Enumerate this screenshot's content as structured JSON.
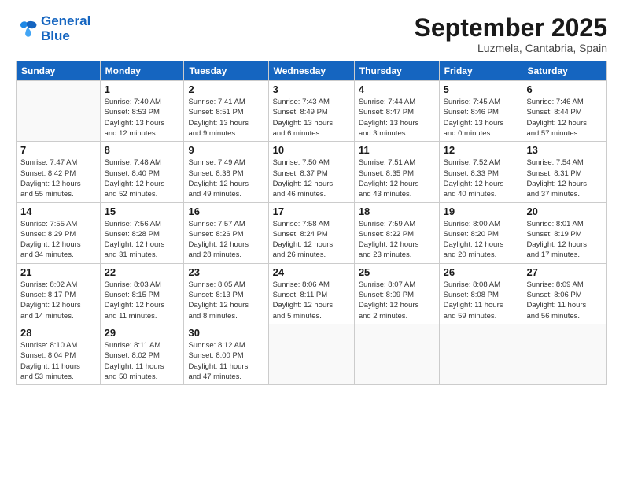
{
  "logo": {
    "line1": "General",
    "line2": "Blue"
  },
  "title": "September 2025",
  "location": "Luzmela, Cantabria, Spain",
  "weekdays": [
    "Sunday",
    "Monday",
    "Tuesday",
    "Wednesday",
    "Thursday",
    "Friday",
    "Saturday"
  ],
  "weeks": [
    [
      {
        "day": "",
        "info": ""
      },
      {
        "day": "1",
        "info": "Sunrise: 7:40 AM\nSunset: 8:53 PM\nDaylight: 13 hours\nand 12 minutes."
      },
      {
        "day": "2",
        "info": "Sunrise: 7:41 AM\nSunset: 8:51 PM\nDaylight: 13 hours\nand 9 minutes."
      },
      {
        "day": "3",
        "info": "Sunrise: 7:43 AM\nSunset: 8:49 PM\nDaylight: 13 hours\nand 6 minutes."
      },
      {
        "day": "4",
        "info": "Sunrise: 7:44 AM\nSunset: 8:47 PM\nDaylight: 13 hours\nand 3 minutes."
      },
      {
        "day": "5",
        "info": "Sunrise: 7:45 AM\nSunset: 8:46 PM\nDaylight: 13 hours\nand 0 minutes."
      },
      {
        "day": "6",
        "info": "Sunrise: 7:46 AM\nSunset: 8:44 PM\nDaylight: 12 hours\nand 57 minutes."
      }
    ],
    [
      {
        "day": "7",
        "info": "Sunrise: 7:47 AM\nSunset: 8:42 PM\nDaylight: 12 hours\nand 55 minutes."
      },
      {
        "day": "8",
        "info": "Sunrise: 7:48 AM\nSunset: 8:40 PM\nDaylight: 12 hours\nand 52 minutes."
      },
      {
        "day": "9",
        "info": "Sunrise: 7:49 AM\nSunset: 8:38 PM\nDaylight: 12 hours\nand 49 minutes."
      },
      {
        "day": "10",
        "info": "Sunrise: 7:50 AM\nSunset: 8:37 PM\nDaylight: 12 hours\nand 46 minutes."
      },
      {
        "day": "11",
        "info": "Sunrise: 7:51 AM\nSunset: 8:35 PM\nDaylight: 12 hours\nand 43 minutes."
      },
      {
        "day": "12",
        "info": "Sunrise: 7:52 AM\nSunset: 8:33 PM\nDaylight: 12 hours\nand 40 minutes."
      },
      {
        "day": "13",
        "info": "Sunrise: 7:54 AM\nSunset: 8:31 PM\nDaylight: 12 hours\nand 37 minutes."
      }
    ],
    [
      {
        "day": "14",
        "info": "Sunrise: 7:55 AM\nSunset: 8:29 PM\nDaylight: 12 hours\nand 34 minutes."
      },
      {
        "day": "15",
        "info": "Sunrise: 7:56 AM\nSunset: 8:28 PM\nDaylight: 12 hours\nand 31 minutes."
      },
      {
        "day": "16",
        "info": "Sunrise: 7:57 AM\nSunset: 8:26 PM\nDaylight: 12 hours\nand 28 minutes."
      },
      {
        "day": "17",
        "info": "Sunrise: 7:58 AM\nSunset: 8:24 PM\nDaylight: 12 hours\nand 26 minutes."
      },
      {
        "day": "18",
        "info": "Sunrise: 7:59 AM\nSunset: 8:22 PM\nDaylight: 12 hours\nand 23 minutes."
      },
      {
        "day": "19",
        "info": "Sunrise: 8:00 AM\nSunset: 8:20 PM\nDaylight: 12 hours\nand 20 minutes."
      },
      {
        "day": "20",
        "info": "Sunrise: 8:01 AM\nSunset: 8:19 PM\nDaylight: 12 hours\nand 17 minutes."
      }
    ],
    [
      {
        "day": "21",
        "info": "Sunrise: 8:02 AM\nSunset: 8:17 PM\nDaylight: 12 hours\nand 14 minutes."
      },
      {
        "day": "22",
        "info": "Sunrise: 8:03 AM\nSunset: 8:15 PM\nDaylight: 12 hours\nand 11 minutes."
      },
      {
        "day": "23",
        "info": "Sunrise: 8:05 AM\nSunset: 8:13 PM\nDaylight: 12 hours\nand 8 minutes."
      },
      {
        "day": "24",
        "info": "Sunrise: 8:06 AM\nSunset: 8:11 PM\nDaylight: 12 hours\nand 5 minutes."
      },
      {
        "day": "25",
        "info": "Sunrise: 8:07 AM\nSunset: 8:09 PM\nDaylight: 12 hours\nand 2 minutes."
      },
      {
        "day": "26",
        "info": "Sunrise: 8:08 AM\nSunset: 8:08 PM\nDaylight: 11 hours\nand 59 minutes."
      },
      {
        "day": "27",
        "info": "Sunrise: 8:09 AM\nSunset: 8:06 PM\nDaylight: 11 hours\nand 56 minutes."
      }
    ],
    [
      {
        "day": "28",
        "info": "Sunrise: 8:10 AM\nSunset: 8:04 PM\nDaylight: 11 hours\nand 53 minutes."
      },
      {
        "day": "29",
        "info": "Sunrise: 8:11 AM\nSunset: 8:02 PM\nDaylight: 11 hours\nand 50 minutes."
      },
      {
        "day": "30",
        "info": "Sunrise: 8:12 AM\nSunset: 8:00 PM\nDaylight: 11 hours\nand 47 minutes."
      },
      {
        "day": "",
        "info": ""
      },
      {
        "day": "",
        "info": ""
      },
      {
        "day": "",
        "info": ""
      },
      {
        "day": "",
        "info": ""
      }
    ]
  ]
}
